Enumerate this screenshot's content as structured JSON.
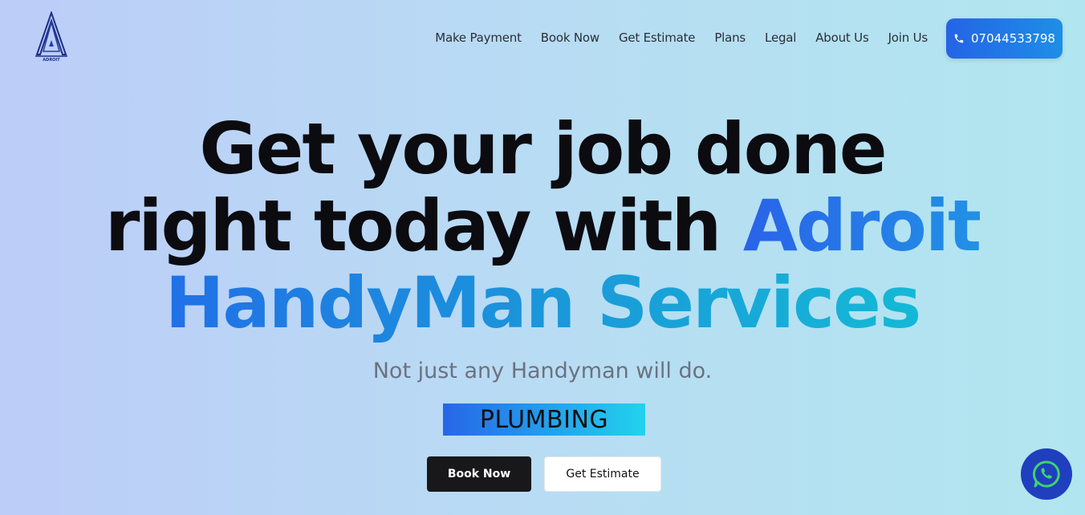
{
  "logo": {
    "icon": "adroit-logo-icon",
    "text": "ADROIT"
  },
  "nav": {
    "items": [
      {
        "label": "Make Payment"
      },
      {
        "label": "Book Now"
      },
      {
        "label": "Get Estimate"
      },
      {
        "label": "Plans"
      },
      {
        "label": "Legal"
      },
      {
        "label": "About Us"
      },
      {
        "label": "Join Us"
      }
    ],
    "phone": {
      "icon": "phone-icon",
      "label": "07044533798"
    }
  },
  "hero": {
    "line1": "Get your job done",
    "line2_plain": "right today with ",
    "line2_accent": "Adroit",
    "line3": "HandyMan Services",
    "subtitle": "Not just any Handyman will do.",
    "service": "PLUMBING",
    "book_label": "Book Now",
    "estimate_label": "Get Estimate"
  },
  "floating": {
    "icon": "whatsapp-icon"
  },
  "colors": {
    "accent_blue": "#2563eb",
    "accent_cyan": "#22d3ee",
    "dark_button": "#18181b",
    "whatsapp_bg": "#1f3fbf"
  }
}
